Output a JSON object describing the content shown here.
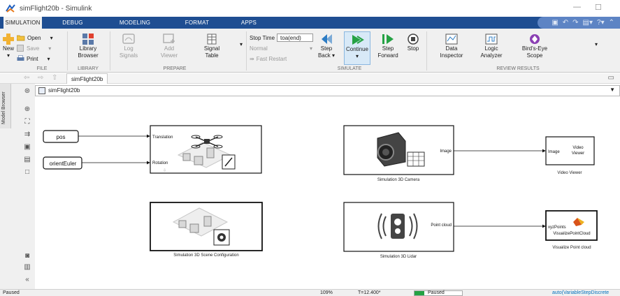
{
  "window": {
    "title": "simFlight20b - Simulink"
  },
  "tabs": [
    "SIMULATION",
    "DEBUG",
    "MODELING",
    "FORMAT",
    "APPS"
  ],
  "ribbon": {
    "file": {
      "new": "New",
      "open": "Open",
      "save": "Save",
      "print": "Print",
      "label": "FILE"
    },
    "library": {
      "browser_line1": "Library",
      "browser_line2": "Browser",
      "label": "LIBRARY"
    },
    "prepare": {
      "log_line1": "Log",
      "log_line2": "Signals",
      "add_line1": "Add",
      "add_line2": "Viewer",
      "signal_line1": "Signal",
      "signal_line2": "Table",
      "label": "PREPARE"
    },
    "simulate": {
      "stop_time_label": "Stop Time",
      "stop_time_value": "toa(end)",
      "mode": "Normal",
      "fast_restart": "Fast Restart",
      "step_back_line1": "Step",
      "step_back_line2": "Back",
      "continue": "Continue",
      "step_forward_line1": "Step",
      "step_forward_line2": "Forward",
      "stop": "Stop",
      "label": "SIMULATE"
    },
    "review": {
      "data_line1": "Data",
      "data_line2": "Inspector",
      "logic_line1": "Logic",
      "logic_line2": "Analyzer",
      "birds_line1": "Bird's-Eye",
      "birds_line2": "Scope",
      "label": "REVIEW RESULTS"
    }
  },
  "explorer": {
    "tab": "simFlight20b",
    "model_browser": "Model Browser"
  },
  "address": {
    "path": "simFlight20b"
  },
  "blocks": {
    "pos": "pos",
    "orient": "orientEuler",
    "translation": "Translation",
    "rotation": "Rotation",
    "image_port": "Image",
    "camera_name": "Simulation 3D Camera",
    "video_in": "Image",
    "video_title_line1": "Video",
    "video_title_line2": "Viewer",
    "video_name": "Video Viewer",
    "scene_name": "Simulation 3D Scene Configuration",
    "cloud_port": "Point cloud",
    "lidar_name": "Simulation 3D Lidar",
    "xyz_port": "xyzPoints",
    "vpc_title": "VisualizePointCloud",
    "vpc_name": "Visualize Point cloud"
  },
  "status": {
    "state": "Paused",
    "zoom": "109%",
    "time": "T=12.400*",
    "progress_state": "Paused",
    "progress_fraction": 0.2,
    "solver": "auto(VariableStepDiscrete"
  },
  "colors": {
    "tabbar": "#1f4e92",
    "accent": "#0072bd",
    "progress": "#25a244"
  }
}
